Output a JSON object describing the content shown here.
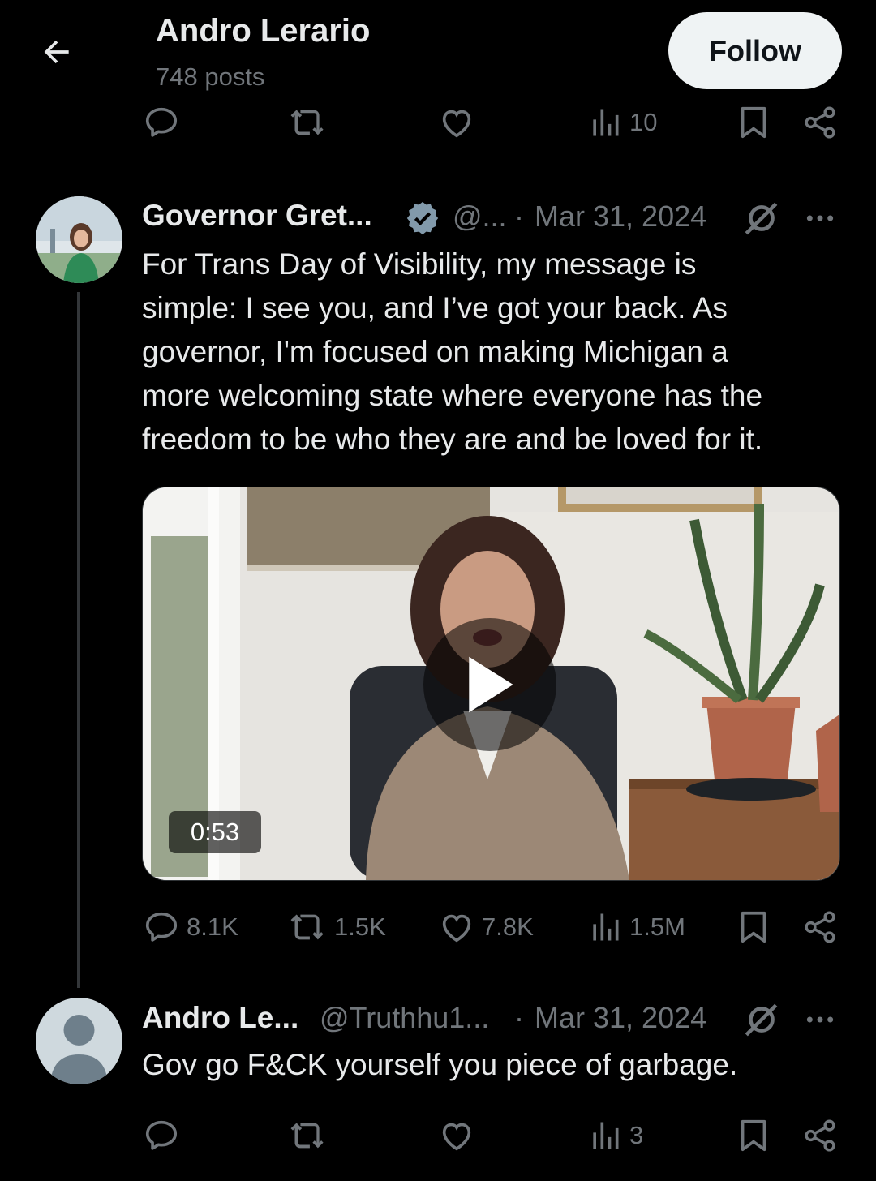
{
  "header": {
    "name": "Andro Lerario",
    "posts": "748 posts",
    "follow_label": "Follow"
  },
  "top_actions": {
    "views": "10"
  },
  "tweet": {
    "author_name": "Governor Gret...",
    "handle": "@...",
    "dot": "·",
    "date": "Mar 31, 2024",
    "text_lines": [
      "For Trans Day of Visibility, my message is",
      "simple: I see you, and I’ve got your back. As",
      "governor, I'm focused on making Michigan a",
      "more welcoming state where everyone has the",
      "freedom to be who they are and be loved for it."
    ],
    "video_duration": "0:53",
    "replies": "8.1K",
    "reposts": "1.5K",
    "likes": "7.8K",
    "views": "1.5M"
  },
  "reply": {
    "author_name": "Andro Le...",
    "handle": "@Truthhu1...",
    "dot": "·",
    "date": "Mar 31, 2024",
    "text": "Gov go F&CK yourself you piece of garbage.",
    "views": "3"
  },
  "colors": {
    "background": "#000000",
    "text": "#e7e9ea",
    "muted": "#71767b",
    "verified": "#829aab",
    "follow_bg": "#eff3f4"
  },
  "icons": [
    "back-arrow-icon",
    "reply-icon",
    "repost-icon",
    "like-icon",
    "views-icon",
    "bookmark-icon",
    "share-icon",
    "verified-badge-icon",
    "grok-icon",
    "more-icon",
    "play-icon"
  ]
}
